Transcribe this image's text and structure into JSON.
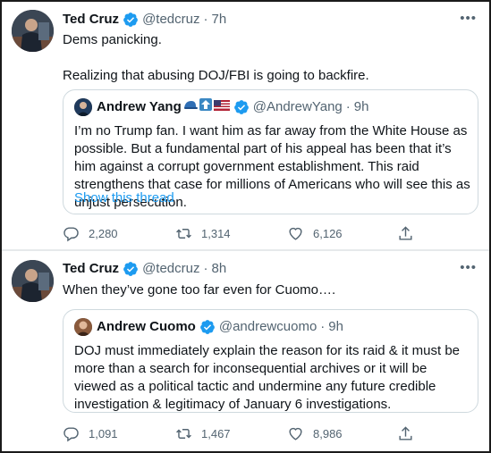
{
  "tweets": [
    {
      "author": {
        "name": "Ted Cruz",
        "handle": "@tedcruz",
        "time": "7h"
      },
      "text": "Dems panicking.\n\nRealizing that abusing DOJ/FBI is going to backfire.",
      "more_icon": "more-icon",
      "quote": {
        "author": {
          "name": "Andrew Yang",
          "handle": "@AndrewYang",
          "time": "9h",
          "name_emojis": [
            "blue-hat",
            "up-arrow",
            "us-flag"
          ]
        },
        "text": "I’m no Trump fan. I want him as far away from the White House as possible. But a fundamental part of his appeal has been that it’s him against a corrupt government establishment. This raid strengthens that case for millions of Americans who will see this as unjust persecution.",
        "show_thread": "Show this thread"
      },
      "actions": {
        "replies": "2,280",
        "retweets": "1,314",
        "likes": "6,126"
      }
    },
    {
      "author": {
        "name": "Ted Cruz",
        "handle": "@tedcruz",
        "time": "8h"
      },
      "text": "When they’ve gone too far even for Cuomo….",
      "more_icon": "more-icon",
      "quote": {
        "author": {
          "name": "Andrew Cuomo",
          "handle": "@andrewcuomo",
          "time": "9h"
        },
        "text": "DOJ must immediately explain the reason for its raid & it must be more than a search for inconsequential archives or it will be viewed as a political tactic and undermine any future credible investigation & legitimacy of January 6 investigations."
      },
      "actions": {
        "replies": "1,091",
        "retweets": "1,467",
        "likes": "8,986"
      }
    }
  ],
  "colors": {
    "verified": "#1d9bf0",
    "link": "#1d9bf0",
    "secondary": "#536471",
    "border": "#cfd9de"
  }
}
